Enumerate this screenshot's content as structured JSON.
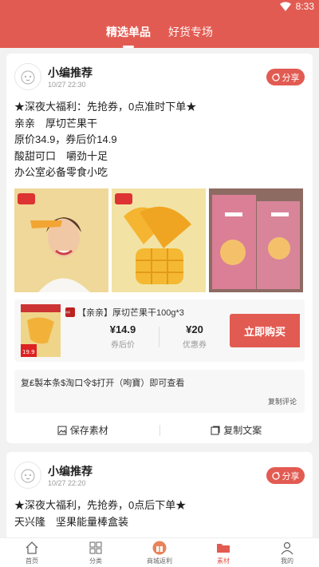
{
  "status": {
    "time": "8:33"
  },
  "tabs": [
    {
      "label": "精选单品",
      "active": true
    },
    {
      "label": "好货专场",
      "active": false
    }
  ],
  "posts": [
    {
      "author": "小编推荐",
      "time": "10/27 22:30",
      "share_label": "分享",
      "lines": [
        "★深夜大福利：先抢券，0点准时下单★",
        "亲亲　厚切芒果干",
        "原价34.9，券后价14.9",
        "酸甜可口　嚼劲十足",
        "办公室必备零食小吃"
      ],
      "product": {
        "badge": "亲亲",
        "title": "【亲亲】厚切芒果干100g*3",
        "thumb_price": "19.9",
        "price": "¥14.9",
        "price_label": "券后价",
        "coupon": "¥20",
        "coupon_label": "优惠券",
        "buy_label": "立即购买"
      },
      "comment": "复₤製本条$淘口令$打开（呴寶）即可查看",
      "copy_comment_label": "复制评论",
      "save_label": "保存素材",
      "copy_text_label": "复制文案"
    },
    {
      "author": "小编推荐",
      "time": "10/27 22:20",
      "share_label": "分享",
      "lines": [
        "★深夜大福利，先抢券，0点后下单★",
        "天兴隆　坚果能量棒盒装"
      ]
    }
  ],
  "bottom_nav": [
    {
      "label": "首页",
      "icon": "home-icon",
      "active": false
    },
    {
      "label": "分类",
      "icon": "grid-icon",
      "active": false
    },
    {
      "label": "商城返利",
      "icon": "gift-icon",
      "active": false
    },
    {
      "label": "素材",
      "icon": "folder-icon",
      "active": true
    },
    {
      "label": "我的",
      "icon": "user-icon",
      "active": false
    }
  ],
  "colors": {
    "primary": "#e25b52",
    "background": "#f2f2f2"
  }
}
